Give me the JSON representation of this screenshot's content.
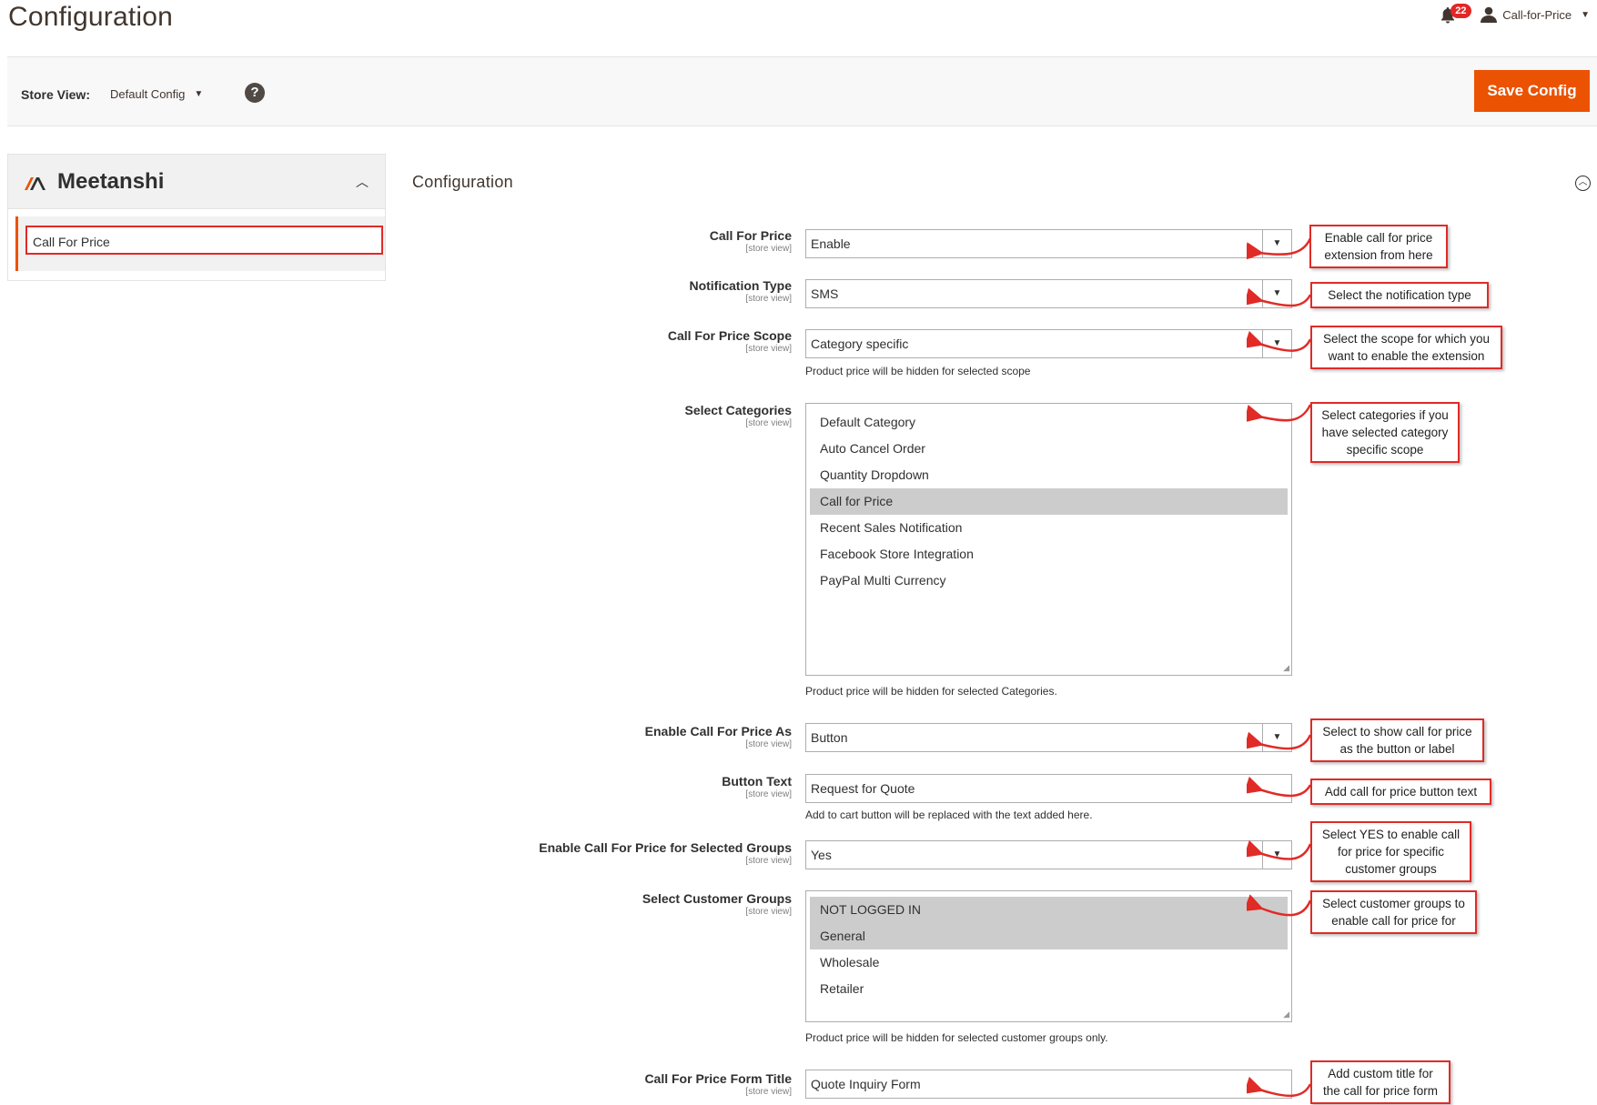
{
  "header": {
    "title": "Configuration",
    "notification_count": "22",
    "user_name": "Call-for-Price"
  },
  "store_bar": {
    "label": "Store View:",
    "value": "Default Config",
    "help": "?",
    "save_label": "Save Config"
  },
  "sidebar": {
    "brand": "Meetanshi",
    "item": "Call For Price"
  },
  "section": {
    "title": "Configuration"
  },
  "scope_text": "[store view]",
  "fields": {
    "call_for_price": {
      "label": "Call For Price",
      "value": "Enable",
      "callout": [
        "Enable call for price",
        "extension from here"
      ]
    },
    "notification_type": {
      "label": "Notification Type",
      "value": "SMS",
      "callout": [
        "Select the notification type"
      ]
    },
    "scope": {
      "label": "Call For Price Scope",
      "value": "Category specific",
      "note": "Product price will be hidden for selected scope",
      "callout": [
        "Select the scope for which you",
        "want to enable the extension"
      ]
    },
    "categories": {
      "label": "Select Categories",
      "options": [
        "Default Category",
        "Auto Cancel Order",
        "Quantity Dropdown",
        "Call for Price",
        "Recent Sales Notification",
        "Facebook Store Integration",
        "PayPal Multi Currency"
      ],
      "selected": [
        "Call for Price"
      ],
      "note": "Product price will be hidden for selected Categories.",
      "callout": [
        "Select categories if you",
        "have selected category",
        "specific scope"
      ]
    },
    "enable_as": {
      "label": "Enable Call For Price As",
      "value": "Button",
      "callout": [
        "Select to show call for price",
        "as the button or label"
      ]
    },
    "button_text": {
      "label": "Button Text",
      "value": "Request for Quote",
      "note": "Add to cart button will be replaced with the text added here.",
      "callout": [
        "Add call for price button text"
      ]
    },
    "selected_groups": {
      "label": "Enable Call For Price for Selected Groups",
      "value": "Yes",
      "callout": [
        "Select YES to enable call",
        "for price for specific",
        "customer groups"
      ]
    },
    "customer_groups": {
      "label": "Select Customer Groups",
      "options": [
        "NOT LOGGED IN",
        "General",
        "Wholesale",
        "Retailer"
      ],
      "selected": [
        "NOT LOGGED IN",
        "General"
      ],
      "note": "Product price will be hidden for selected customer groups only.",
      "callout": [
        "Select customer groups to",
        "enable call for price for"
      ]
    },
    "form_title": {
      "label": "Call For Price Form Title",
      "value": "Quote Inquiry Form",
      "callout": [
        "Add custom title for",
        "the call for price form"
      ]
    }
  },
  "colors": {
    "accent": "#eb5202",
    "callout_border": "#e02b27",
    "selected_option": "#cccccc"
  }
}
